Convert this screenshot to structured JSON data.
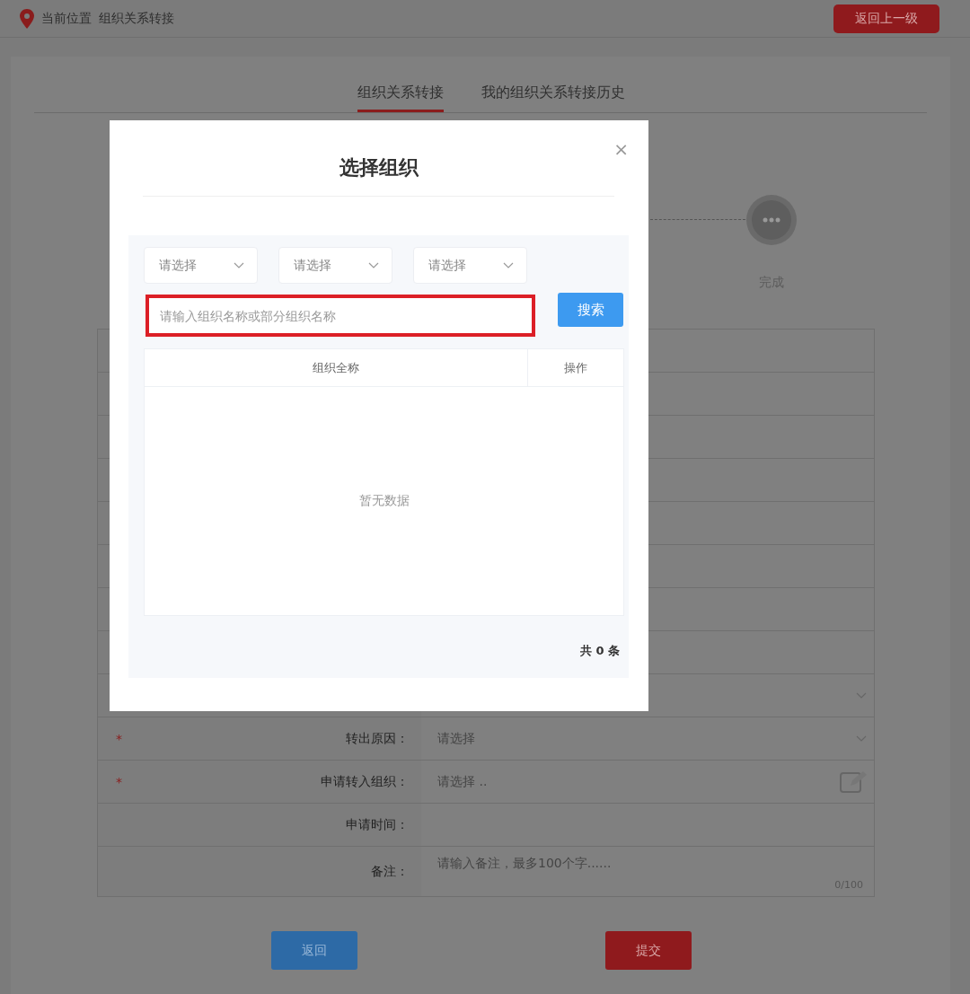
{
  "breadcrumb": {
    "label": "当前位置",
    "path": "组织关系转接"
  },
  "back_button": "返回上一级",
  "tabs": [
    {
      "label": "组织关系转接",
      "selected": true
    },
    {
      "label": "我的组织关系转接历史",
      "selected": false
    }
  ],
  "step": {
    "label": "完成"
  },
  "form_rows": [
    {
      "kind": "select"
    },
    {
      "kind": "select",
      "label": "转出原因：",
      "required_mark": "*",
      "value": "请选择"
    },
    {
      "kind": "picker",
      "label": "申请转入组织：",
      "required_mark": "*",
      "value": "请选择 .."
    },
    {
      "kind": "text",
      "label": "申请时间："
    },
    {
      "kind": "textarea",
      "label": "备注：",
      "placeholder": "请输入备注，最多100个字......",
      "counter": "0/100"
    }
  ],
  "buttons": [
    {
      "label": "返回",
      "kind": "secondary"
    },
    {
      "label": "提交",
      "kind": "primary"
    }
  ],
  "dialog": {
    "title": "选择组织",
    "close": "×",
    "selects": [
      {
        "placeholder": "请选择"
      },
      {
        "placeholder": "请选择"
      },
      {
        "placeholder": "请选择"
      }
    ],
    "search": {
      "placeholder": "请输入组织名称或部分组织名称",
      "highlighted": true
    },
    "search_button": "搜索",
    "table": {
      "columns": [
        "组织全称",
        "操作"
      ],
      "empty_text": "暂无数据"
    },
    "total": "共 0 条"
  }
}
